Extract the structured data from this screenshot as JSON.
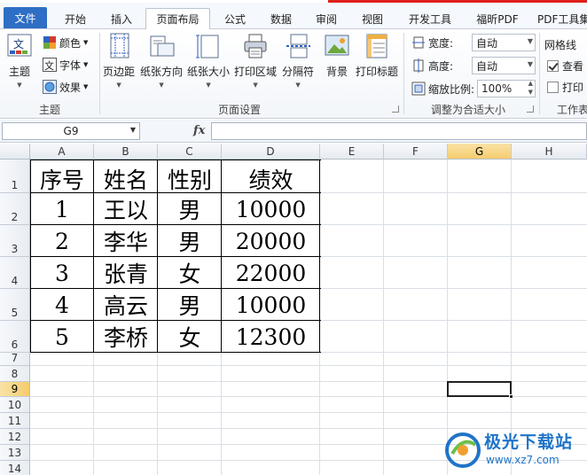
{
  "ribbon_tabs": {
    "file": "文件",
    "home": "开始",
    "insert": "插入",
    "page_layout": "页面布局",
    "formulas": "公式",
    "data": "数据",
    "review": "审阅",
    "view": "视图",
    "developer": "开发工具",
    "foxit_pdf": "福昕PDF",
    "pdf_tools": "PDF工具集"
  },
  "theme_group": {
    "label": "主题",
    "themes_button": "主题",
    "colors_button": "颜色",
    "fonts_button": "字体",
    "effects_button": "效果"
  },
  "page_setup_group": {
    "label": "页面设置",
    "margins": "页边距",
    "orientation": "纸张方向",
    "size": "纸张大小",
    "print_area": "打印区域",
    "breaks": "分隔符",
    "background": "背景",
    "print_titles": "打印标题"
  },
  "scale_group": {
    "label": "调整为合适大小",
    "width_label": "宽度:",
    "width_value": "自动",
    "height_label": "高度:",
    "height_value": "自动",
    "scale_label": "缩放比例:",
    "scale_value": "100%"
  },
  "sheet_options_group": {
    "label": "工作表",
    "gridlines_label": "网格线",
    "view_label": "查看",
    "print_label": "打印",
    "view_checked": true,
    "print_checked": false
  },
  "formula_bar": {
    "name_box": "G9",
    "fx": "fx",
    "formula": ""
  },
  "columns": [
    "A",
    "B",
    "C",
    "D",
    "E",
    "F",
    "G",
    "H"
  ],
  "rows": [
    "1",
    "2",
    "3",
    "4",
    "5",
    "6",
    "7",
    "8",
    "9",
    "10",
    "11",
    "12",
    "13",
    "14"
  ],
  "selected_cell": "G9",
  "table": {
    "headers": [
      "序号",
      "姓名",
      "性别",
      "绩效"
    ],
    "rows": [
      [
        "1",
        "王以",
        "男",
        "10000"
      ],
      [
        "2",
        "李华",
        "男",
        "20000"
      ],
      [
        "3",
        "张青",
        "女",
        "22000"
      ],
      [
        "4",
        "高云",
        "男",
        "10000"
      ],
      [
        "5",
        "李桥",
        "女",
        "12300"
      ]
    ]
  },
  "watermark": {
    "title": "极光下载站",
    "url": "www.xz7.com"
  },
  "colors": {
    "file_tab": "#2e6ec4",
    "selected_header": "#f5cc6d",
    "watermark": "#1f74c8"
  }
}
